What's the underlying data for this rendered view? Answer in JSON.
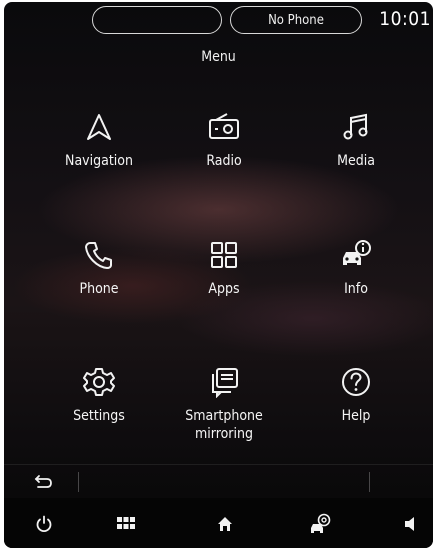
{
  "status": {
    "left_pill_label": "",
    "phone_status": "No Phone",
    "clock": "10:01"
  },
  "menu": {
    "title": "Menu",
    "tiles": [
      {
        "label": "Navigation",
        "icon": "navigation-arrow-icon"
      },
      {
        "label": "Radio",
        "icon": "radio-icon"
      },
      {
        "label": "Media",
        "icon": "music-note-icon"
      },
      {
        "label": "Phone",
        "icon": "phone-handset-icon"
      },
      {
        "label": "Apps",
        "icon": "apps-grid-icon"
      },
      {
        "label": "Info",
        "icon": "car-info-icon"
      },
      {
        "label": "Settings",
        "icon": "gear-icon"
      },
      {
        "label": "Smartphone\nmirroring",
        "icon": "smartphone-mirroring-icon"
      },
      {
        "label": "Help",
        "icon": "help-circle-icon"
      }
    ]
  },
  "nav_bar": {
    "back": "back-icon",
    "items": [
      "power-icon",
      "menu-grid-icon",
      "home-icon",
      "car-settings-icon",
      "volume-icon"
    ]
  },
  "colors": {
    "text": "#f2f2f2",
    "background": "#0e0c0e",
    "pill_border": "#d8d8d8"
  }
}
